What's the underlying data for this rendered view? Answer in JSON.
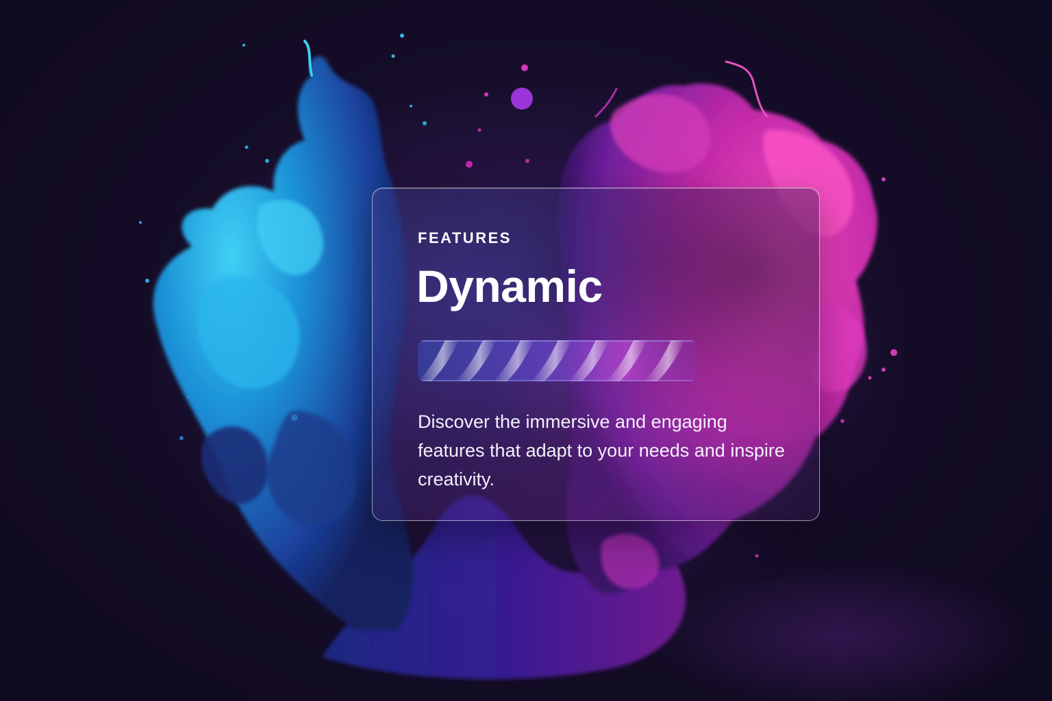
{
  "card": {
    "eyebrow": "FEATURES",
    "title": "Dynamic",
    "description": "Discover the immersive and engaging features that adapt to your needs and inspire creativity."
  },
  "colors": {
    "background": "#140c24",
    "blue_ink": "#1fa3e0",
    "magenta_ink": "#d92fb5",
    "text": "#ffffff"
  },
  "icons": {
    "decorative_bar": "wave-pattern"
  }
}
